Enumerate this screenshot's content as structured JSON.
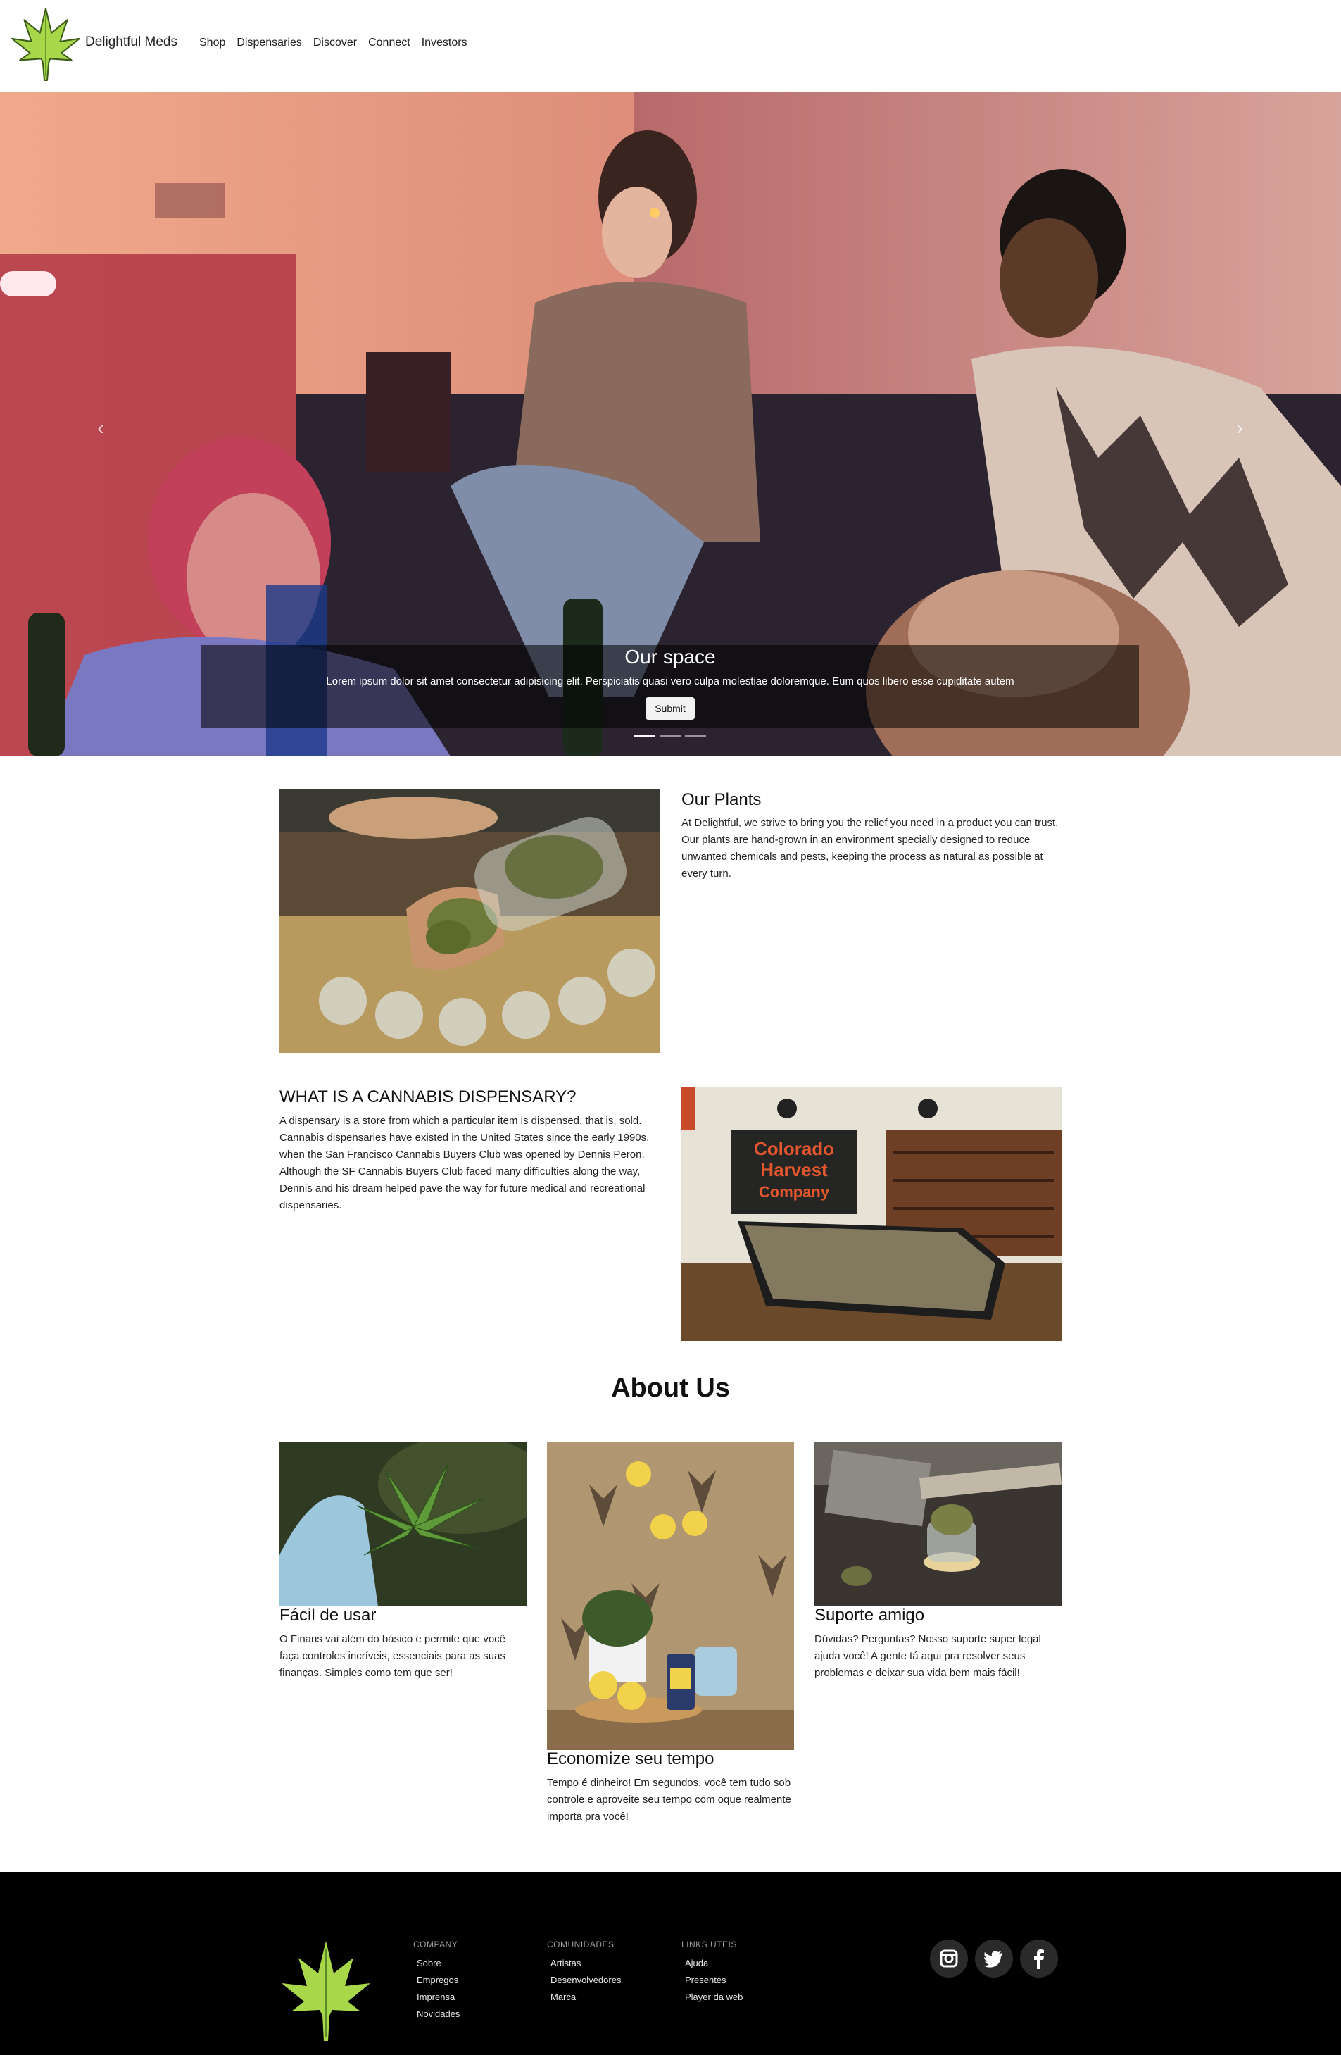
{
  "navbar": {
    "brand": "Delightful Meds",
    "links": [
      "Shop",
      "Dispensaries",
      "Discover",
      "Connect",
      "Investors"
    ]
  },
  "hero": {
    "title": "Our space",
    "text": "Lorem ipsum dolor sit amet consectetur adipisicing elit. Perspiciatis quasi vero culpa molestiae doloremque. Eum quos libero esse cupiditate autem",
    "button": "Submit",
    "slide_count": 3,
    "active_slide": 1
  },
  "features": [
    {
      "title": "Our Plants",
      "text": "At Delightful, we strive to bring you the relief you need in a product you can trust. Our plants are hand-grown in an environment specially designed to reduce unwanted chemicals and pests, keeping the process as natural as possible at every turn."
    },
    {
      "title": "WHAT IS A CANNABIS DISPENSARY?",
      "text": "A dispensary is a store from which a particular item is dispensed, that is, sold. Cannabis dispensaries have existed in the United States since the early 1990s, when the San Francisco Cannabis Buyers Club was opened by Dennis Peron. Although the SF Cannabis Buyers Club faced many difficulties along the way, Dennis and his dream helped pave the way for future medical and recreational dispensaries.",
      "store_sign": "Colorado Harvest Company"
    }
  ],
  "about": {
    "heading": "About Us",
    "cards": [
      {
        "title": "Fácil de usar",
        "text": "O Finans vai além do básico e permite que você faça controles incríveis, essenciais para as suas finanças. Simples como tem que ser!"
      },
      {
        "title": "Economize seu tempo",
        "text": "Tempo é dinheiro! Em segundos, você tem tudo sob controle e aproveite seu tempo com oque realmente importa pra você!"
      },
      {
        "title": "Suporte amigo",
        "text": "Dúvidas? Perguntas? Nosso suporte super legal ajuda você! A gente tá aqui pra resolver seus problemas e deixar sua vida bem mais fácil!"
      }
    ]
  },
  "footer": {
    "columns": [
      {
        "title": "COMPANY",
        "links": [
          "Sobre",
          "Empregos",
          "Imprensa",
          "Novidades"
        ]
      },
      {
        "title": "COMUNIDADES",
        "links": [
          "Artistas",
          "Desenvolvedores",
          "Marca"
        ]
      },
      {
        "title": "LINKS UTEIS",
        "links": [
          "Ajuda",
          "Presentes",
          "Player da web"
        ]
      }
    ],
    "social_icons": [
      "instagram-icon",
      "twitter-icon",
      "facebook-icon"
    ]
  },
  "colors": {
    "leaf_green": "#a8d84a",
    "leaf_dark": "#4f8a1e",
    "footer_bg": "#000000",
    "caption_bg": "rgba(0,0,0,0.55)"
  }
}
